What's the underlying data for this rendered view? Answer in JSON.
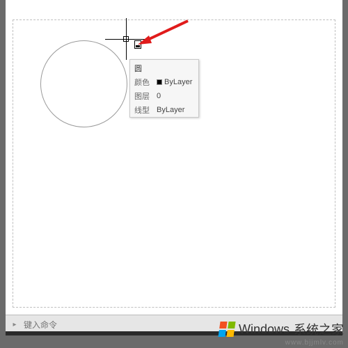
{
  "tooltip": {
    "title": "圆",
    "rows": [
      {
        "label": "颜色",
        "value": "ByLayer",
        "swatch": "#000000"
      },
      {
        "label": "图层",
        "value": "0"
      },
      {
        "label": "线型",
        "value": "ByLayer"
      }
    ]
  },
  "commandline": {
    "placeholder": "键入命令"
  },
  "watermark": {
    "brand": "Windows",
    "suffix": "系统之家",
    "url": "www.bjjmlv.com"
  }
}
